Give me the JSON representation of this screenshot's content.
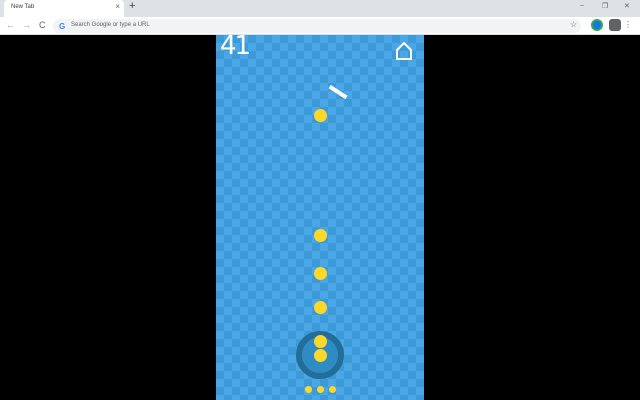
{
  "browser": {
    "tab_title": "New Tab",
    "tab_close": "×",
    "new_tab": "+",
    "minimize": "–",
    "restore": "❐",
    "close": "✕",
    "back": "←",
    "forward": "→",
    "reload": "C",
    "google_g": "G",
    "omnibox_placeholder": "Search Google or type a URL",
    "bookmark_star": "☆",
    "menu": "⋮"
  },
  "game": {
    "score": "41",
    "home_icon": "home-icon",
    "queued_balls": 3,
    "colors": {
      "background": "#3d9ad9",
      "ball": "#fdd829",
      "ring": "#236e99",
      "bar": "#ffffff"
    }
  }
}
